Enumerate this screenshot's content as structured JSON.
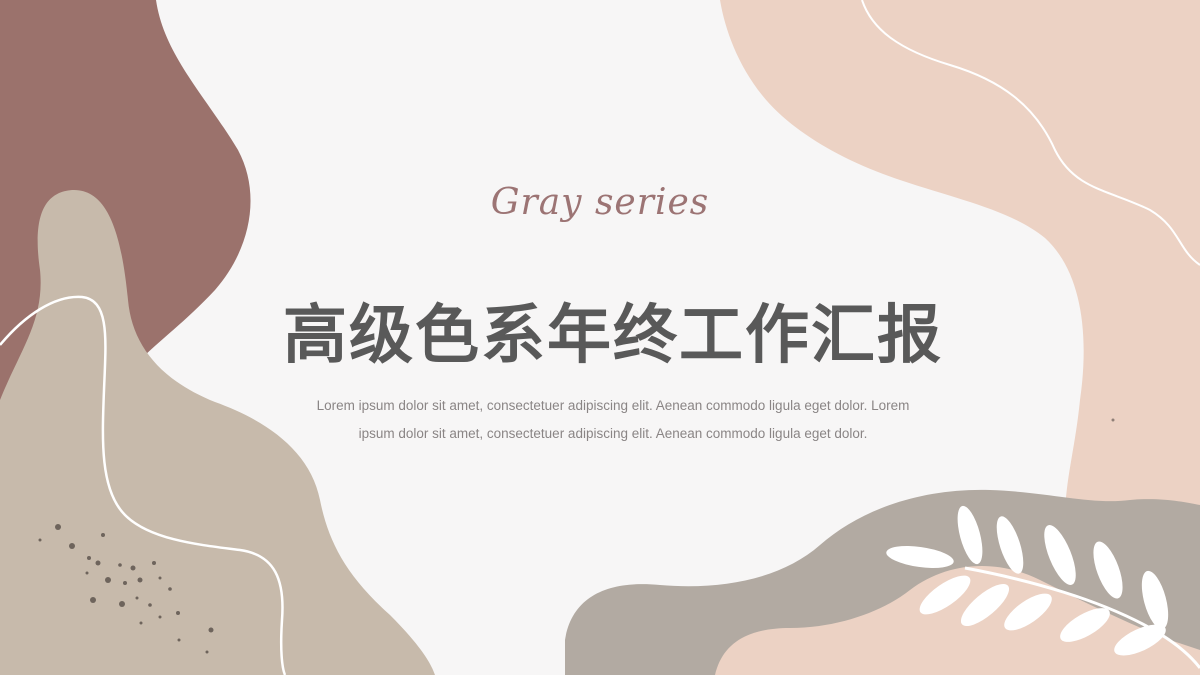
{
  "slide": {
    "script_title": "Gray series",
    "main_title": "高级色系年终工作汇报",
    "description": "Lorem ipsum dolor sit amet, consectetuer adipiscing elit. Aenean commodo ligula eget dolor. Lorem ipsum dolor sit amet, consectetuer adipiscing elit. Aenean commodo ligula eget dolor."
  },
  "colors": {
    "background": "#f7f6f6",
    "mauve": "#9b726c",
    "taupe": "#c7baab",
    "peach": "#ecd2c4",
    "gray": "#b2aaa2",
    "title_text": "#595959",
    "script_text": "#9c7474",
    "body_text": "#8a8585"
  },
  "icons": [
    "leaf-branch-icon",
    "decorative-dots"
  ]
}
